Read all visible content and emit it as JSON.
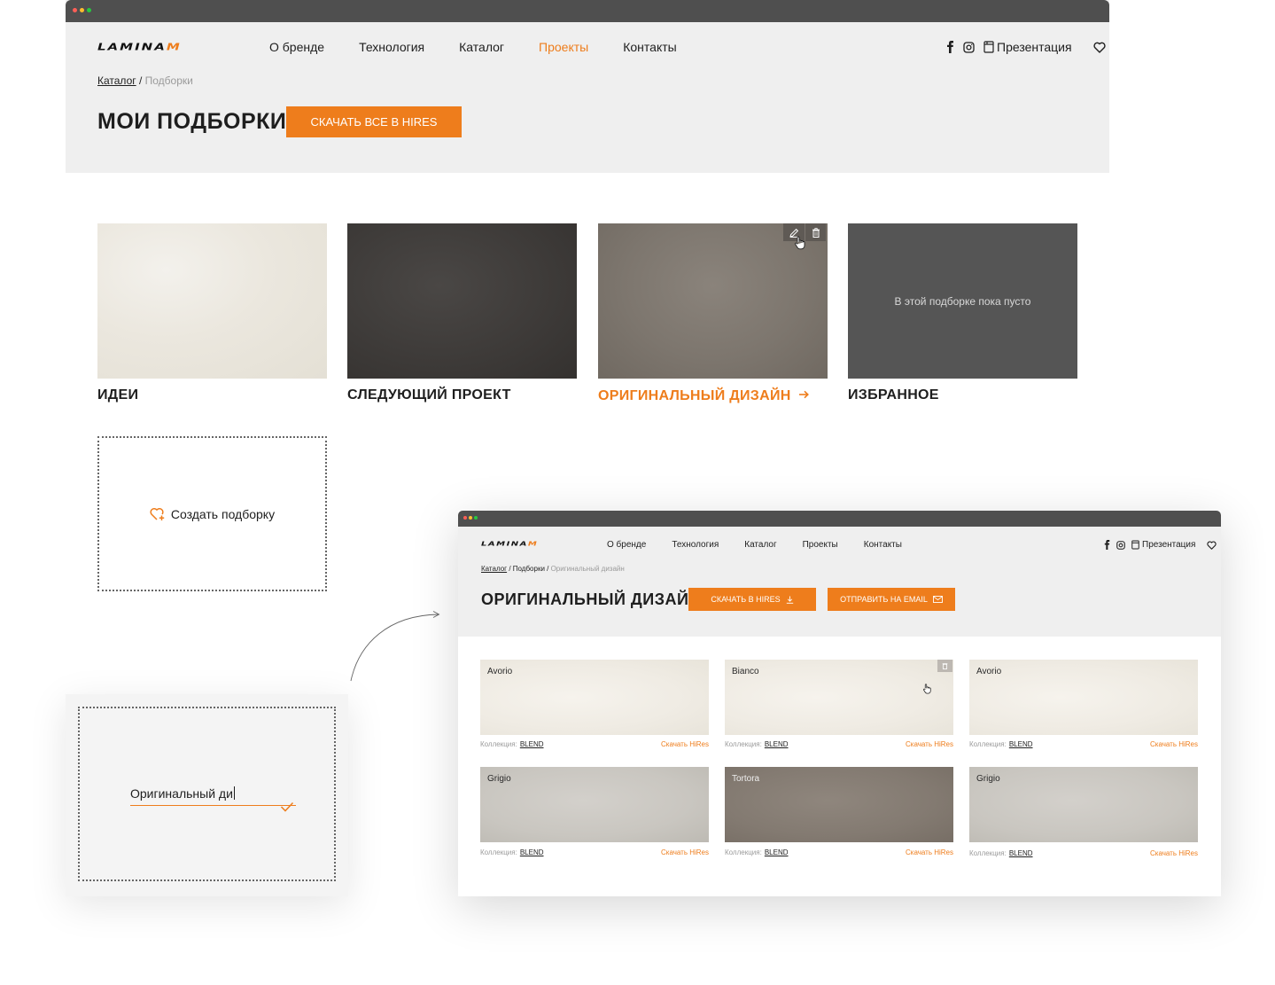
{
  "brand": {
    "logo_main": "LAMINA",
    "logo_accent": "M",
    "accent": "#ee7d1c"
  },
  "nav": [
    {
      "label": "О бренде",
      "active": false
    },
    {
      "label": "Технология",
      "active": false
    },
    {
      "label": "Каталог",
      "active": false
    },
    {
      "label": "Проекты",
      "active": true
    },
    {
      "label": "Контакты",
      "active": false
    }
  ],
  "header_right": {
    "icons": [
      "facebook-icon",
      "instagram-icon",
      "presentation-icon",
      "heart-icon"
    ],
    "presentation": "Презентация"
  },
  "main": {
    "breadcrumb": {
      "catalog": "Каталог",
      "sep": " / ",
      "current": "Подборки"
    },
    "title": "МОИ ПОДБОРКИ",
    "download_all": "СКАЧАТЬ ВСЕ В HIRES",
    "collections": [
      {
        "title": "ИДЕИ",
        "texture": "cream"
      },
      {
        "title": "СЛЕДУЮЩИЙ ПРОЕКТ",
        "texture": "dark"
      },
      {
        "title": "ОРИГИНАЛЬНЫЙ ДИЗАЙН",
        "texture": "taupe",
        "highlighted": true
      },
      {
        "title": "ИЗБРАННОЕ",
        "texture": "empty",
        "empty_text": "В этой подборке пока пусто"
      }
    ],
    "card_action_icons": [
      "edit-icon",
      "trash-icon"
    ],
    "create_label": "Создать подборку",
    "new_name_value": "Оригинальный ди"
  },
  "detail": {
    "breadcrumb": {
      "catalog": "Каталог",
      "sep1": " / ",
      "selections": "Подборки",
      "sep2": " / ",
      "current": "Оригинальный дизайн"
    },
    "title": "ОРИГИНАЛЬНЫЙ ДИЗАЙН",
    "btn_hires": "СКАЧАТЬ В HIRES",
    "btn_email": "ОТПРАВИТЬ НА EMAIL",
    "tiles": [
      {
        "name": "Avorio",
        "texture": "cream",
        "collection_label": "Коллекция:",
        "collection": "BLEND",
        "download": "Скачать HiRes"
      },
      {
        "name": "Bianco",
        "texture": "cream",
        "collection_label": "Коллекция:",
        "collection": "BLEND",
        "download": "Скачать HiRes"
      },
      {
        "name": "Avorio",
        "texture": "cream",
        "collection_label": "Коллекция:",
        "collection": "BLEND",
        "download": "Скачать HiRes"
      },
      {
        "name": "Grigio",
        "texture": "grey",
        "collection_label": "Коллекция:",
        "collection": "BLEND",
        "download": "Скачать HiRes"
      },
      {
        "name": "Tortora",
        "texture": "taupe",
        "collection_label": "Коллекция:",
        "collection": "BLEND",
        "download": "Скачать HiRes"
      },
      {
        "name": "Grigio",
        "texture": "grey",
        "collection_label": "Коллекция:",
        "collection": "BLEND",
        "download": "Скачать HiRes"
      }
    ]
  }
}
